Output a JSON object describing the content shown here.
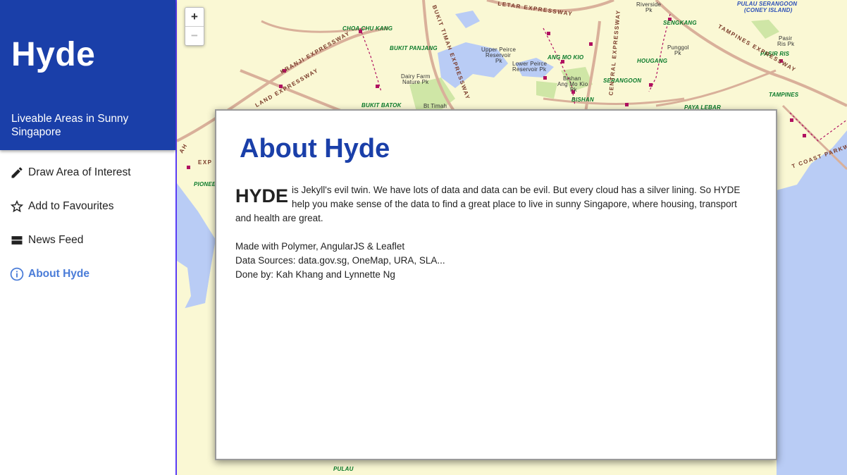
{
  "app": {
    "title": "Hyde",
    "subtitle": "Liveable Areas in Sunny Singapore",
    "accent_color": "#1a3fa9"
  },
  "menu": [
    {
      "label": "Draw Area of Interest",
      "icon": "pencil-icon"
    },
    {
      "label": "Add to Favourites",
      "icon": "star-outline-icon"
    },
    {
      "label": "News Feed",
      "icon": "view-stream-icon"
    },
    {
      "label": "About Hyde",
      "icon": "info-outline-icon",
      "active": true
    }
  ],
  "zoom": {
    "in": "+",
    "out": "−"
  },
  "map_labels": {
    "choa_chu_kang": "CHOA CHU KANG",
    "bukit_panjang": "BUKIT PANJANG",
    "upper_peirce": "Upper Peirce",
    "reservoir": "Reservoir",
    "pk": "Pk",
    "lower_peirce": "Lower Peirce",
    "lower_peirce_res": "Reservoir Pk",
    "ang_mo_kio": "ANG MO KIO",
    "bishan": "Bishan",
    "ang_mo_kio_pk": "Ang Mo Kio",
    "pk2": "Pk",
    "serangoon": "SERANGOON",
    "bishan_caps": "BISHAN",
    "dairy_farm": "Dairy Farm",
    "nature_pk": "Nature Pk",
    "bukit_batok": "BUKIT BATOK",
    "bt_timah": "Bt Timah",
    "sengkang": "SENGKANG",
    "hougang": "HOUGANG",
    "punggol": "Punggol",
    "punggol_pk": "Pk",
    "riverside": "Riverside",
    "riverside_pk": "Pk",
    "pasir_ris_pk": "Pasir",
    "pasir_ris_pk2": "Ris Pk",
    "pasir_ris": "PASIR RIS",
    "tampines": "TAMPINES",
    "paya_lebar": "PAYA LEBAR",
    "pulau_serangoon": "PULAU SERANGOON",
    "coney_island": "(CONEY ISLAND)",
    "pioneer": "PIONEE",
    "pulau": "PULAU",
    "pasir_top": "PASIR",
    "seletar_expressway": "LETAR EXPRESSWAY",
    "kranji_expressway": "KRANJI EXPRESSWAY",
    "island_expressway": "LAND EXPRESSWAY",
    "bukit_timah_expressway": "BUKIT TIMAH EXPRESSWAY",
    "central_expressway": "CENTRAL EXPRESSWAY",
    "tpe": "TAMPINES EXPRESSWAY",
    "pie": "PAN ISLAND EXPRESSWAY",
    "ecp": "T COAST PARKWAY",
    "ah": "AH",
    "exp": "EXP"
  },
  "dialog": {
    "title": "About Hyde",
    "dropcap": "HYDE",
    "intro": "is Jekyll's evil twin. We have lots of data and data can be evil. But every cloud has a silver lining. So HYDE help you make sense of the data to find a great place to live in sunny Singapore, where housing, transport and health are great.",
    "made_with": "Made with Polymer, AngularJS & Leaflet",
    "data_sources": "Data Sources: data.gov.sg, OneMap, URA, SLA...",
    "done_by": "Done by: Kah Khang and Lynnette Ng"
  }
}
